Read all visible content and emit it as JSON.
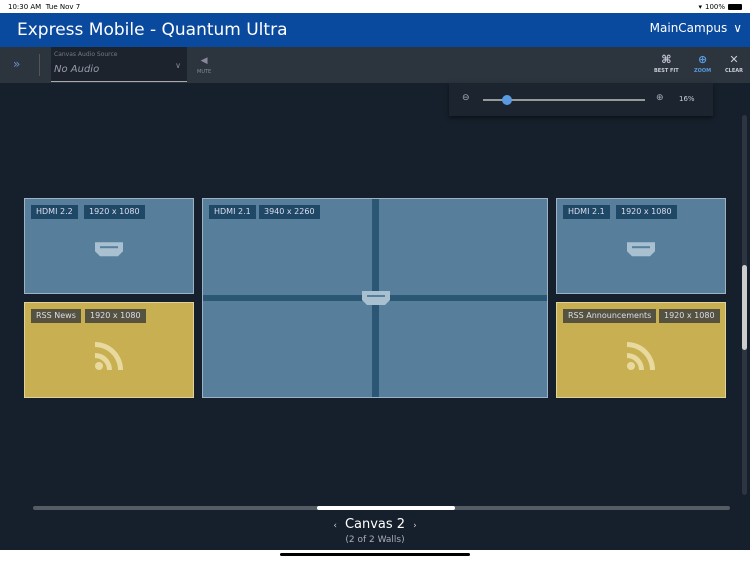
{
  "status_bar": {
    "time": "10:30 AM",
    "date": "Tue Nov 7",
    "battery": "100%"
  },
  "header": {
    "title": "Express Mobile - Quantum Ultra",
    "campus": "MainCampus"
  },
  "toolbar": {
    "audio_label": "Canvas Audio Source",
    "audio_value": "No Audio",
    "mute": "MUTE",
    "best_fit": "BEST FIT",
    "zoom": "ZOOM",
    "clear": "CLEAR"
  },
  "zoom": {
    "value_label": "16%",
    "slider_fraction": 0.15
  },
  "tiles": [
    {
      "source": "HDMI 2.2",
      "resolution": "1920 x 1080",
      "type": "hdmi"
    },
    {
      "source": "HDMI 2.1",
      "resolution": "3940 x 2260",
      "type": "hdmi"
    },
    {
      "source": "HDMI 2.1",
      "resolution": "1920 x 1080",
      "type": "hdmi"
    },
    {
      "source": "RSS News",
      "resolution": "1920 x 1080",
      "type": "rss"
    },
    {
      "source": "RSS Announcements",
      "resolution": "1920 x 1080",
      "type": "rss"
    }
  ],
  "canvas_nav": {
    "name": "Canvas 2",
    "walls": "(2 of 2 Walls)"
  },
  "colors": {
    "header": "#0a4a9e",
    "canvas_bg": "#16202c",
    "hdmi": "#577f9c",
    "rss": "#c8b052",
    "accent": "#5a9be0"
  }
}
